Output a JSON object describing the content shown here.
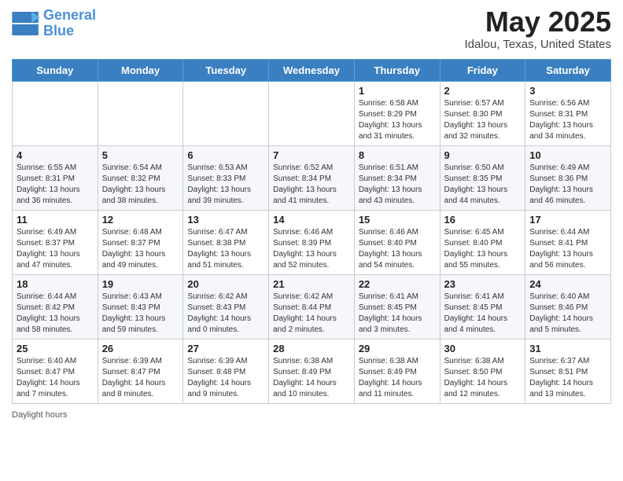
{
  "header": {
    "logo_line1": "General",
    "logo_line2": "Blue",
    "month_title": "May 2025",
    "location": "Idalou, Texas, United States"
  },
  "days_of_week": [
    "Sunday",
    "Monday",
    "Tuesday",
    "Wednesday",
    "Thursday",
    "Friday",
    "Saturday"
  ],
  "weeks": [
    [
      {
        "day": "",
        "info": ""
      },
      {
        "day": "",
        "info": ""
      },
      {
        "day": "",
        "info": ""
      },
      {
        "day": "",
        "info": ""
      },
      {
        "day": "1",
        "info": "Sunrise: 6:58 AM\nSunset: 8:29 PM\nDaylight: 13 hours\nand 31 minutes."
      },
      {
        "day": "2",
        "info": "Sunrise: 6:57 AM\nSunset: 8:30 PM\nDaylight: 13 hours\nand 32 minutes."
      },
      {
        "day": "3",
        "info": "Sunrise: 6:56 AM\nSunset: 8:31 PM\nDaylight: 13 hours\nand 34 minutes."
      }
    ],
    [
      {
        "day": "4",
        "info": "Sunrise: 6:55 AM\nSunset: 8:31 PM\nDaylight: 13 hours\nand 36 minutes."
      },
      {
        "day": "5",
        "info": "Sunrise: 6:54 AM\nSunset: 8:32 PM\nDaylight: 13 hours\nand 38 minutes."
      },
      {
        "day": "6",
        "info": "Sunrise: 6:53 AM\nSunset: 8:33 PM\nDaylight: 13 hours\nand 39 minutes."
      },
      {
        "day": "7",
        "info": "Sunrise: 6:52 AM\nSunset: 8:34 PM\nDaylight: 13 hours\nand 41 minutes."
      },
      {
        "day": "8",
        "info": "Sunrise: 6:51 AM\nSunset: 8:34 PM\nDaylight: 13 hours\nand 43 minutes."
      },
      {
        "day": "9",
        "info": "Sunrise: 6:50 AM\nSunset: 8:35 PM\nDaylight: 13 hours\nand 44 minutes."
      },
      {
        "day": "10",
        "info": "Sunrise: 6:49 AM\nSunset: 8:36 PM\nDaylight: 13 hours\nand 46 minutes."
      }
    ],
    [
      {
        "day": "11",
        "info": "Sunrise: 6:49 AM\nSunset: 8:37 PM\nDaylight: 13 hours\nand 47 minutes."
      },
      {
        "day": "12",
        "info": "Sunrise: 6:48 AM\nSunset: 8:37 PM\nDaylight: 13 hours\nand 49 minutes."
      },
      {
        "day": "13",
        "info": "Sunrise: 6:47 AM\nSunset: 8:38 PM\nDaylight: 13 hours\nand 51 minutes."
      },
      {
        "day": "14",
        "info": "Sunrise: 6:46 AM\nSunset: 8:39 PM\nDaylight: 13 hours\nand 52 minutes."
      },
      {
        "day": "15",
        "info": "Sunrise: 6:46 AM\nSunset: 8:40 PM\nDaylight: 13 hours\nand 54 minutes."
      },
      {
        "day": "16",
        "info": "Sunrise: 6:45 AM\nSunset: 8:40 PM\nDaylight: 13 hours\nand 55 minutes."
      },
      {
        "day": "17",
        "info": "Sunrise: 6:44 AM\nSunset: 8:41 PM\nDaylight: 13 hours\nand 56 minutes."
      }
    ],
    [
      {
        "day": "18",
        "info": "Sunrise: 6:44 AM\nSunset: 8:42 PM\nDaylight: 13 hours\nand 58 minutes."
      },
      {
        "day": "19",
        "info": "Sunrise: 6:43 AM\nSunset: 8:43 PM\nDaylight: 13 hours\nand 59 minutes."
      },
      {
        "day": "20",
        "info": "Sunrise: 6:42 AM\nSunset: 8:43 PM\nDaylight: 14 hours\nand 0 minutes."
      },
      {
        "day": "21",
        "info": "Sunrise: 6:42 AM\nSunset: 8:44 PM\nDaylight: 14 hours\nand 2 minutes."
      },
      {
        "day": "22",
        "info": "Sunrise: 6:41 AM\nSunset: 8:45 PM\nDaylight: 14 hours\nand 3 minutes."
      },
      {
        "day": "23",
        "info": "Sunrise: 6:41 AM\nSunset: 8:45 PM\nDaylight: 14 hours\nand 4 minutes."
      },
      {
        "day": "24",
        "info": "Sunrise: 6:40 AM\nSunset: 8:46 PM\nDaylight: 14 hours\nand 5 minutes."
      }
    ],
    [
      {
        "day": "25",
        "info": "Sunrise: 6:40 AM\nSunset: 8:47 PM\nDaylight: 14 hours\nand 7 minutes."
      },
      {
        "day": "26",
        "info": "Sunrise: 6:39 AM\nSunset: 8:47 PM\nDaylight: 14 hours\nand 8 minutes."
      },
      {
        "day": "27",
        "info": "Sunrise: 6:39 AM\nSunset: 8:48 PM\nDaylight: 14 hours\nand 9 minutes."
      },
      {
        "day": "28",
        "info": "Sunrise: 6:38 AM\nSunset: 8:49 PM\nDaylight: 14 hours\nand 10 minutes."
      },
      {
        "day": "29",
        "info": "Sunrise: 6:38 AM\nSunset: 8:49 PM\nDaylight: 14 hours\nand 11 minutes."
      },
      {
        "day": "30",
        "info": "Sunrise: 6:38 AM\nSunset: 8:50 PM\nDaylight: 14 hours\nand 12 minutes."
      },
      {
        "day": "31",
        "info": "Sunrise: 6:37 AM\nSunset: 8:51 PM\nDaylight: 14 hours\nand 13 minutes."
      }
    ]
  ],
  "footer": {
    "label": "Daylight hours"
  }
}
